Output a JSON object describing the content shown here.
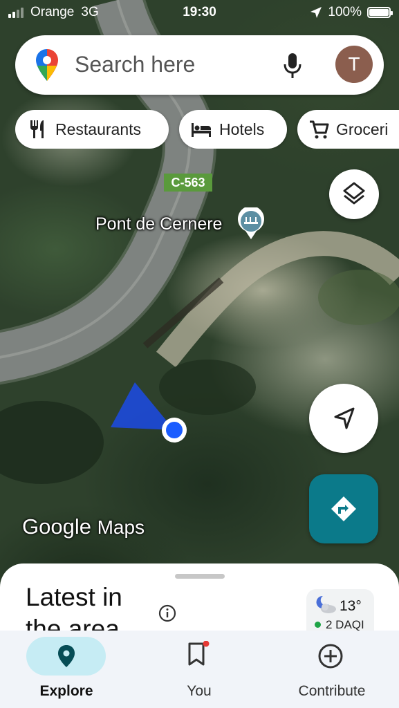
{
  "status_bar": {
    "carrier": "Orange",
    "network": "3G",
    "time": "19:30",
    "battery": "100%"
  },
  "search": {
    "placeholder": "Search here",
    "avatar_initial": "T"
  },
  "chips": [
    {
      "label": "Restaurants",
      "icon": "fork-knife-icon"
    },
    {
      "label": "Hotels",
      "icon": "bed-icon"
    },
    {
      "label": "Groceri",
      "icon": "cart-icon"
    }
  ],
  "map": {
    "road_label": "C-563",
    "poi_label": "Pont de Cernere",
    "watermark_brand": "Google",
    "watermark_product": "Maps"
  },
  "sheet": {
    "title": "Latest in the area",
    "weather_temp": "13°",
    "air_quality": "2 DAQI"
  },
  "bottom_nav": [
    {
      "label": "Explore",
      "icon": "location-pin-icon",
      "active": true
    },
    {
      "label": "You",
      "icon": "bookmark-icon",
      "active": false
    },
    {
      "label": "Contribute",
      "icon": "add-circle-icon",
      "active": false
    }
  ],
  "colors": {
    "accent": "#0b7a8a",
    "explore_pill": "#c6ecf4",
    "location_dot": "#1a5cff",
    "road_label_bg": "#5a9a3c"
  }
}
